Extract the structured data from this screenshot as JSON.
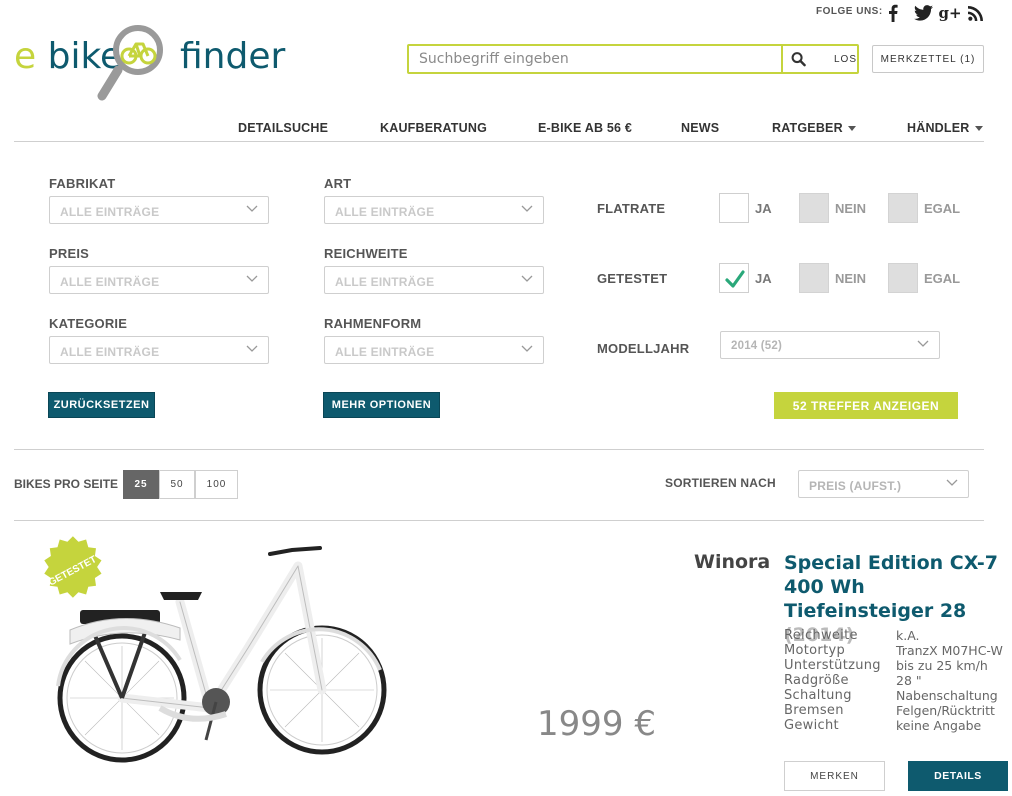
{
  "header": {
    "follow_label": "FOLGE UNS:",
    "social": [
      "facebook-icon",
      "twitter-icon",
      "google-plus-icon",
      "rss-icon"
    ],
    "social_glyphs": [
      "f",
      "t",
      "g+",
      "rss"
    ],
    "logo_left": "e bike",
    "logo_right": "finder",
    "search_placeholder": "Suchbegriff eingeben",
    "search_button": "LOS",
    "merkzettel": "MERKZETTEL (1)"
  },
  "nav": [
    "DETAILSUCHE",
    "KAUFBERATUNG",
    "E-BIKE AB 56 €",
    "NEWS",
    "RATGEBER",
    "HÄNDLER"
  ],
  "filters": {
    "fabrikat": {
      "label": "FABRIKAT",
      "value": "ALLE EINTRÄGE"
    },
    "art": {
      "label": "ART",
      "value": "ALLE EINTRÄGE"
    },
    "preis": {
      "label": "PREIS",
      "value": "ALLE EINTRÄGE"
    },
    "reichweite": {
      "label": "REICHWEITE",
      "value": "ALLE EINTRÄGE"
    },
    "kategorie": {
      "label": "KATEGORIE",
      "value": "ALLE EINTRÄGE"
    },
    "rahmenform": {
      "label": "RAHMENFORM",
      "value": "ALLE EINTRÄGE"
    },
    "flatrate": {
      "label": "FLATRATE",
      "options": [
        "JA",
        "NEIN",
        "EGAL"
      ],
      "checked": ""
    },
    "getestet": {
      "label": "GETESTET",
      "options": [
        "JA",
        "NEIN",
        "EGAL"
      ],
      "checked": "JA"
    },
    "modelljahr": {
      "label": "MODELLJAHR",
      "value": "2014 (52)"
    },
    "reset_button": "ZURÜCKSETZEN",
    "more_button": "MEHR OPTIONEN",
    "show_button": "52 TREFFER ANZEIGEN"
  },
  "results": {
    "per_page_label": "BIKES PRO SEITE",
    "per_page": [
      "25",
      "50",
      "100"
    ],
    "per_page_active": "25",
    "sort_label": "SORTIEREN NACH",
    "sort_value": "PREIS (AUFST.)"
  },
  "product": {
    "badge": "GETESTET",
    "brand": "Winora",
    "title": "Special Edition CX-7 400 Wh Tiefeinsteiger 28",
    "year": "(2014)",
    "price": "1999 €",
    "specs": [
      {
        "key": "Reichweite",
        "value": "k.A."
      },
      {
        "key": "Motortyp",
        "value": "TranzX M07HC-W"
      },
      {
        "key": "Unterstützung",
        "value": "bis zu 25 km/h"
      },
      {
        "key": "Radgröße",
        "value": "28 \""
      },
      {
        "key": "Schaltung",
        "value": "Nabenschaltung"
      },
      {
        "key": "Bremsen",
        "value": "Felgen/Rücktritt"
      },
      {
        "key": "Gewicht",
        "value": "keine Angabe"
      }
    ],
    "merken_button": "MERKEN",
    "details_button": "DETAILS"
  },
  "colors": {
    "accent_green": "#c5d43d",
    "primary_teal": "#0e5a6e",
    "check_green": "#2aa87a"
  }
}
